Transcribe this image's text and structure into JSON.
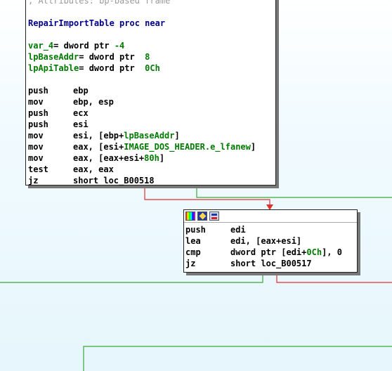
{
  "block1": {
    "attributes_comment": "; Attributes: bp-based frame",
    "proc_header": "RepairImportTable proc near",
    "vars": [
      {
        "name": "var_4",
        "eq": "= ",
        "type": "dword ptr ",
        "value": "-4"
      },
      {
        "name": "lpBaseAddr",
        "eq": "= ",
        "type": "dword ptr  ",
        "value": "8"
      },
      {
        "name": "lpApiTable",
        "eq": "= ",
        "type": "dword ptr  ",
        "value": "0Ch"
      }
    ],
    "instructions": [
      {
        "mnemonic": "push",
        "pre": "ebp",
        "hl": "",
        "post": ""
      },
      {
        "mnemonic": "mov",
        "pre": "ebp, esp",
        "hl": "",
        "post": ""
      },
      {
        "mnemonic": "push",
        "pre": "ecx",
        "hl": "",
        "post": ""
      },
      {
        "mnemonic": "push",
        "pre": "esi",
        "hl": "",
        "post": ""
      },
      {
        "mnemonic": "mov",
        "pre": "esi, [ebp+",
        "hl": "lpBaseAddr",
        "post": "]"
      },
      {
        "mnemonic": "mov",
        "pre": "eax, [esi+",
        "hl": "IMAGE_DOS_HEADER.e_lfanew",
        "post": "]"
      },
      {
        "mnemonic": "mov",
        "pre": "eax, [eax+esi+",
        "hl": "80h",
        "post": "]"
      },
      {
        "mnemonic": "test",
        "pre": "eax, eax",
        "hl": "",
        "post": ""
      },
      {
        "mnemonic": "jz",
        "pre": "short loc_B00518",
        "hl": "",
        "post": ""
      }
    ]
  },
  "block2": {
    "icons": [
      "color-icon",
      "rename-icon",
      "group-icon"
    ],
    "instructions": [
      {
        "mnemonic": "push",
        "pre": "edi",
        "hl": "",
        "post": ""
      },
      {
        "mnemonic": "lea",
        "pre": "edi, [eax+esi]",
        "hl": "",
        "post": ""
      },
      {
        "mnemonic": "cmp",
        "pre": "dword ptr [edi+",
        "hl": "0Ch",
        "post": "], 0"
      },
      {
        "mnemonic": "jz",
        "pre": "short loc_B00517",
        "hl": "",
        "post": ""
      }
    ]
  },
  "colors": {
    "edge_true": "#3aa83a",
    "edge_false": "#e03030",
    "text_blue": "#00008b",
    "text_green": "#007a00"
  }
}
